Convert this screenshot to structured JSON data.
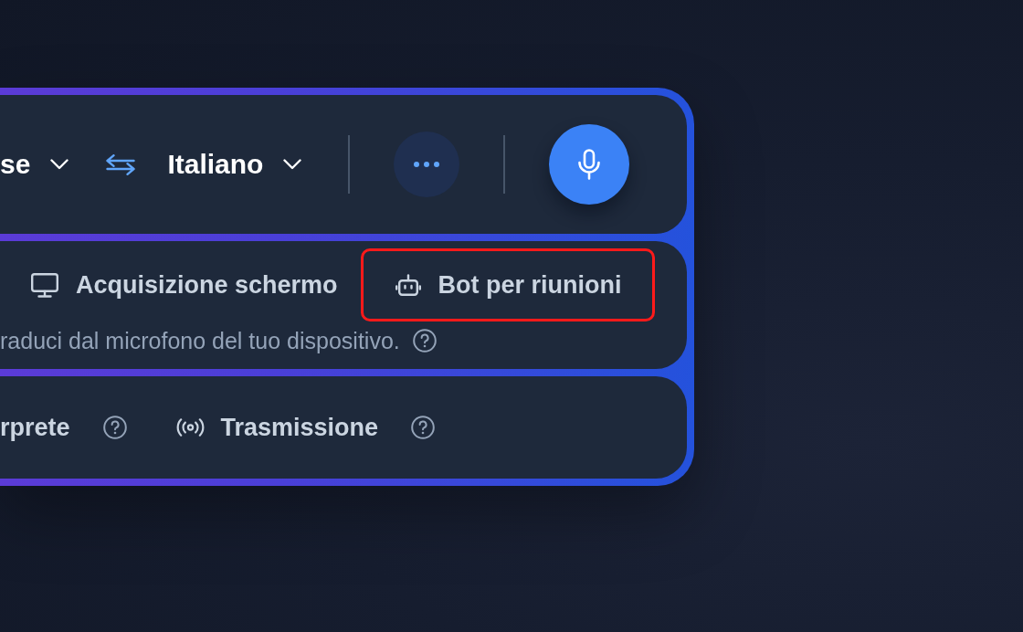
{
  "language_bar": {
    "source_language": {
      "label": "se"
    },
    "target_language": {
      "label": "Italiano"
    }
  },
  "modes": [
    {
      "label": "Acquisizione schermo",
      "kind": "screen",
      "highlighted": false
    },
    {
      "label": "Bot per riunioni",
      "kind": "bot",
      "highlighted": true
    }
  ],
  "mode_description": "raduci dal microfono del tuo dispositivo.",
  "options": [
    {
      "label": "rprete",
      "kind": "interpreter"
    },
    {
      "label": "Trasmissione",
      "kind": "broadcast"
    }
  ]
}
